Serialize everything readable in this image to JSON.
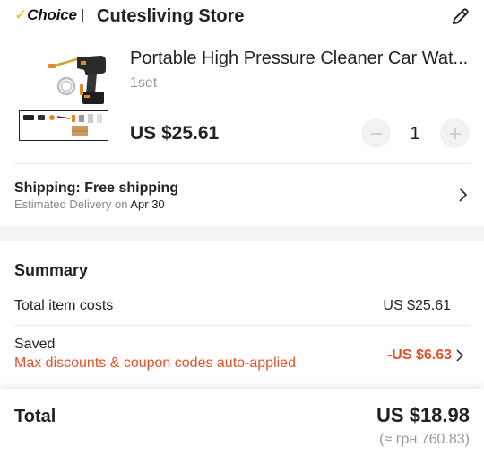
{
  "store": {
    "choice_label": "Choice",
    "choice_check": "✓",
    "name": "Cutesliving Store",
    "edit_icon": "pencil-icon"
  },
  "product": {
    "title": "Portable High Pressure Cleaner Car Wat...",
    "variant": "1set",
    "price": "US $25.61",
    "quantity": "1",
    "image_icon": "pressure-washer-gun-image",
    "thumb_icon": "accessories-thumbnail-image"
  },
  "shipping": {
    "title": "Shipping: Free shipping",
    "estimate_prefix": "Estimated Delivery on",
    "date": "Apr 30"
  },
  "summary": {
    "title": "Summary",
    "item_costs_label": "Total item costs",
    "item_costs_value": "US $25.61",
    "saved_label": "Saved",
    "saved_sub": "Max discounts & coupon codes auto-applied",
    "saved_value": "-US $6.63"
  },
  "total": {
    "label": "Total",
    "value": "US $18.98",
    "local": "(≈ грн.760.83)"
  },
  "colors": {
    "choice_check": "#f2b705",
    "discount": "#e0532a",
    "muted": "#999999",
    "band": "#f4f4f4"
  }
}
